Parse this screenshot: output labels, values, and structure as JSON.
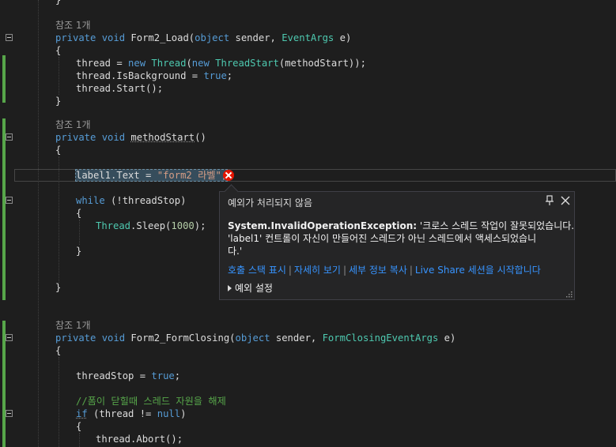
{
  "codelens": {
    "refs_1": "참조 1개",
    "refs_2": "참조 1개",
    "refs_3": "참조 1개"
  },
  "code": {
    "l0_brace": "}",
    "load": {
      "k1": "private",
      "k2": "void",
      "name": "Form2_Load",
      "po": "(",
      "k3": "object",
      "a1": " sender, ",
      "t1": "EventArgs",
      "a2": " e)"
    },
    "l_open1": "{",
    "l_thread": {
      "a": "thread = ",
      "k": "new",
      "t1": "Thread",
      "b": "(",
      "k2": "new",
      "sp": " ",
      "t2": "ThreadStart",
      "c": "(methodStart));"
    },
    "l_isbg": {
      "a": "thread.IsBackground = ",
      "k": "true",
      "b": ";"
    },
    "l_start": "thread.Start();",
    "l_close1": "}",
    "ms": {
      "k1": "private",
      "k2": "void",
      "name": "methodStart",
      "rest": "()"
    },
    "l_open2": "{",
    "l_label": {
      "a": "label1.Text = ",
      "s": "\"form2 라벨\"",
      "b": ";"
    },
    "l_while": {
      "k": "while",
      "rest": " (!threadStop)"
    },
    "l_open3": "{",
    "l_sleep": {
      "t": "Thread",
      "a": ".Sleep(",
      "n": "1000",
      "b": ");"
    },
    "l_close3": "}",
    "l_close2": "}",
    "fc": {
      "k1": "private",
      "k2": "void",
      "name": "Form2_FormClosing",
      "po": "(",
      "k3": "object",
      "a1": " sender, ",
      "t1": "FormClosingEventArgs",
      "a2": " e)"
    },
    "l_open4": "{",
    "l_tstop": {
      "a": "threadStop = ",
      "k": "true",
      "b": ";"
    },
    "l_comment": "//폼이 닫힐때 스레드 자원을 해제",
    "l_if": {
      "k": "if",
      "a": " (thread != ",
      "k2": "null",
      "b": ")"
    },
    "l_open5": "{",
    "l_abort": "thread.Abort();"
  },
  "exception_popup": {
    "title": "예외가 처리되지 않음",
    "exception_type": "System.InvalidOperationException:",
    "message_line1": " '크로스 스레드 작업이 잘못되었습니다.",
    "message_line2": "'label1' 컨트롤이 자신이 만들어진 스레드가 아닌 스레드에서 액세스되었습니",
    "message_line3": "다.'",
    "links": [
      "호출 스택 표시",
      "자세히 보기",
      "세부 정보 복사",
      "Live Share 세션을 시작합니다"
    ],
    "settings_label": "예외 설정"
  },
  "colors": {
    "background": "#1e1e1e",
    "keyword": "#569cd6",
    "type": "#4ec9b0",
    "string": "#d69d85",
    "comment": "#57a64a",
    "link": "#3794ff",
    "error": "#e51400"
  },
  "icons": [
    "error-icon",
    "pin-icon",
    "close-icon",
    "expand-triangle-icon",
    "resize-grip-icon",
    "fold-toggle-icon"
  ]
}
